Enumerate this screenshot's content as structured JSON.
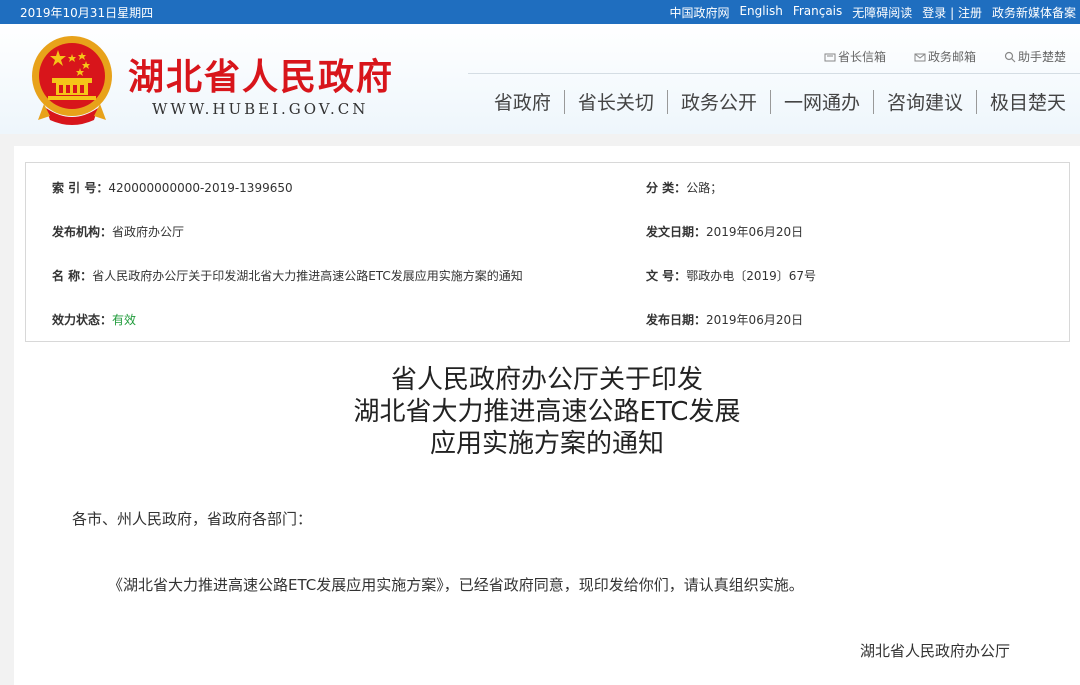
{
  "topbar": {
    "date": "2019年10月31日星期四",
    "links": [
      "中国政府网",
      "English",
      "Français",
      "无障碍阅读",
      "登录 | 注册",
      "政务新媒体备案"
    ]
  },
  "header": {
    "title": "湖北省人民政府",
    "url": "WWW.HUBEI.GOV.CN",
    "util": {
      "mailbox": "省长信箱",
      "email": "政务邮箱",
      "assistant": "助手楚楚"
    },
    "nav": [
      "省政府",
      "省长关切",
      "政务公开",
      "一网通办",
      "咨询建议",
      "极目楚天"
    ]
  },
  "meta": {
    "index_label": "索 引 号：",
    "index_value": "420000000000-2019-1399650",
    "category_label": "分    类：",
    "category_value": "公路；",
    "issuer_label": "发布机构：",
    "issuer_value": "省政府办公厅",
    "issue_date_label": "发文日期：",
    "issue_date_value": "2019年06月20日",
    "name_label": "名    称：",
    "name_value": "省人民政府办公厅关于印发湖北省大力推进高速公路ETC发展应用实施方案的通知",
    "doc_no_label": "文    号：",
    "doc_no_value": "鄂政办电〔2019〕67号",
    "status_label": "效力状态：",
    "status_value": "有效",
    "publish_date_label": "发布日期：",
    "publish_date_value": "2019年06月20日"
  },
  "article": {
    "title_lines": [
      "省人民政府办公厅关于印发",
      "湖北省大力推进高速公路ETC发展",
      "应用实施方案的通知"
    ],
    "salutation": "各市、州人民政府，省政府各部门：",
    "body": "《湖北省大力推进高速公路ETC发展应用实施方案》，已经省政府同意，现印发给你们，请认真组织实施。",
    "signature": "湖北省人民政府办公厅"
  },
  "colors": {
    "topbar": "#1f6ebf",
    "title_red": "#d8151b",
    "status_green": "#1f9b3a"
  }
}
